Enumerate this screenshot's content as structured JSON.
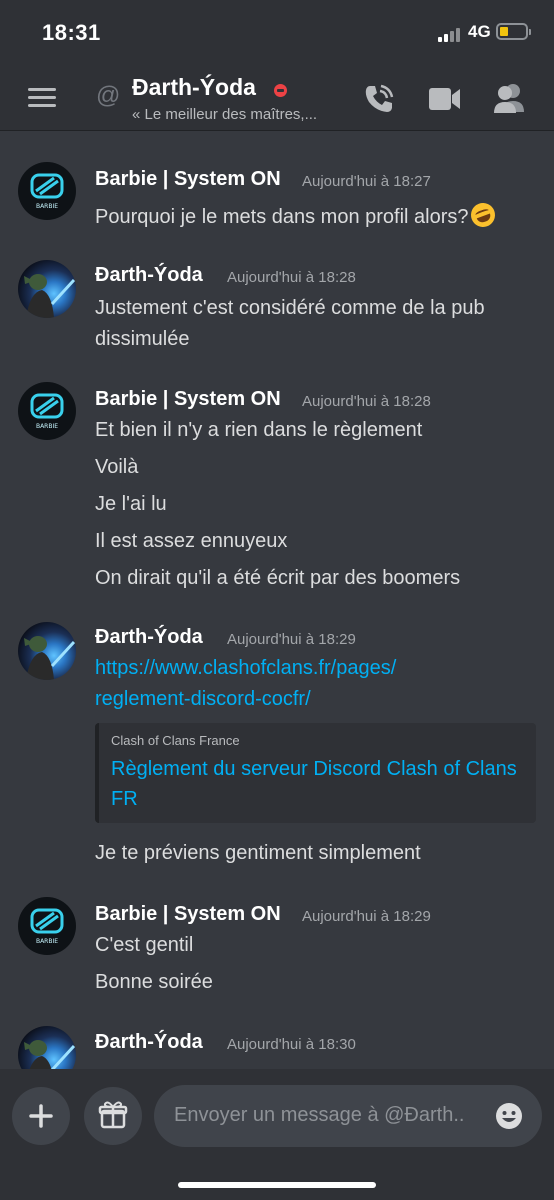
{
  "status_bar": {
    "time": "18:31",
    "network": "4G"
  },
  "header": {
    "at_symbol": "@",
    "name": "Đarth-Ýoda",
    "subtitle": "« Le meilleur des maîtres,..."
  },
  "messages": [
    {
      "author": "Barbie | System ON",
      "timestamp": "Aujourd'hui à 18:27",
      "avatar": "barbie",
      "lines": [
        "Pourquoi je le mets dans mon profil alors?"
      ],
      "emoji": "rolling-on-floor-laughing"
    },
    {
      "author": "Đarth-Ýoda",
      "timestamp": "Aujourd'hui à 18:28",
      "avatar": "yoda",
      "lines": [
        "Justement c'est considéré comme de la pub",
        "dissimulée"
      ]
    },
    {
      "author": "Barbie | System ON",
      "timestamp": "Aujourd'hui à 18:28",
      "avatar": "barbie",
      "lines": [
        "Et bien il n'y a rien dans le règlement",
        "Voilà",
        "Je l'ai lu",
        "Il est assez ennuyeux",
        "On dirait qu'il a été écrit par des boomers"
      ]
    },
    {
      "author": "Đarth-Ýoda",
      "timestamp": "Aujourd'hui à 18:29",
      "avatar": "yoda",
      "link_lines": [
        "https://www.clashofclans.fr/pages/",
        "reglement-discord-cocfr/"
      ],
      "embed": {
        "provider": "Clash of Clans France",
        "title": "Règlement du serveur Discord Clash of Clans FR"
      },
      "after_embed": "Je te préviens gentiment  simplement"
    },
    {
      "author": "Barbie | System ON",
      "timestamp": "Aujourd'hui à 18:29",
      "avatar": "barbie",
      "lines": [
        "C'est gentil",
        "Bonne soirée"
      ]
    },
    {
      "author": "Đarth-Ýoda",
      "timestamp": "Aujourd'hui à 18:30",
      "avatar": "yoda",
      "lines": []
    }
  ],
  "avatar_badge_text": "BARBIE",
  "composer": {
    "placeholder": "Envoyer un message à @Đarth.."
  },
  "colors": {
    "background": "#36393f",
    "header": "#2f3136",
    "link": "#00b0f4",
    "dnd": "#ed4245",
    "battery": "#f1c40f"
  },
  "icons": [
    "menu-icon",
    "at-icon",
    "dnd-status-icon",
    "voice-call-icon",
    "video-call-icon",
    "members-icon",
    "plus-icon",
    "gift-icon",
    "emoji-icon"
  ]
}
